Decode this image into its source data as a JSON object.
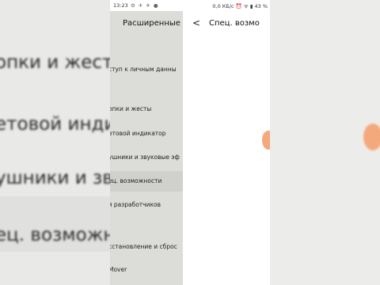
{
  "status_bar": {
    "time": "13:23",
    "left_icons": "⚙ ✈ ✈ ●",
    "right_text": "0,0 КБ/с ⏰ ᯤ ▮ 43 %"
  },
  "left_panel": {
    "title": "Расширенные н",
    "items": [
      "ступ к личным данны",
      "опки и жесты",
      "етовой индикатор",
      "ушники и звуковые эф",
      "ец. возможности",
      "я разработчиков",
      "сстановление и сброс",
      "Mover"
    ]
  },
  "right_panel": {
    "back_glyph": "<",
    "title": "Спец. возмо"
  },
  "blurred_background": {
    "lines": [
      "опки и жесты",
      "етовой индика",
      "ушники и звук",
      "ец. возможнос"
    ]
  }
}
